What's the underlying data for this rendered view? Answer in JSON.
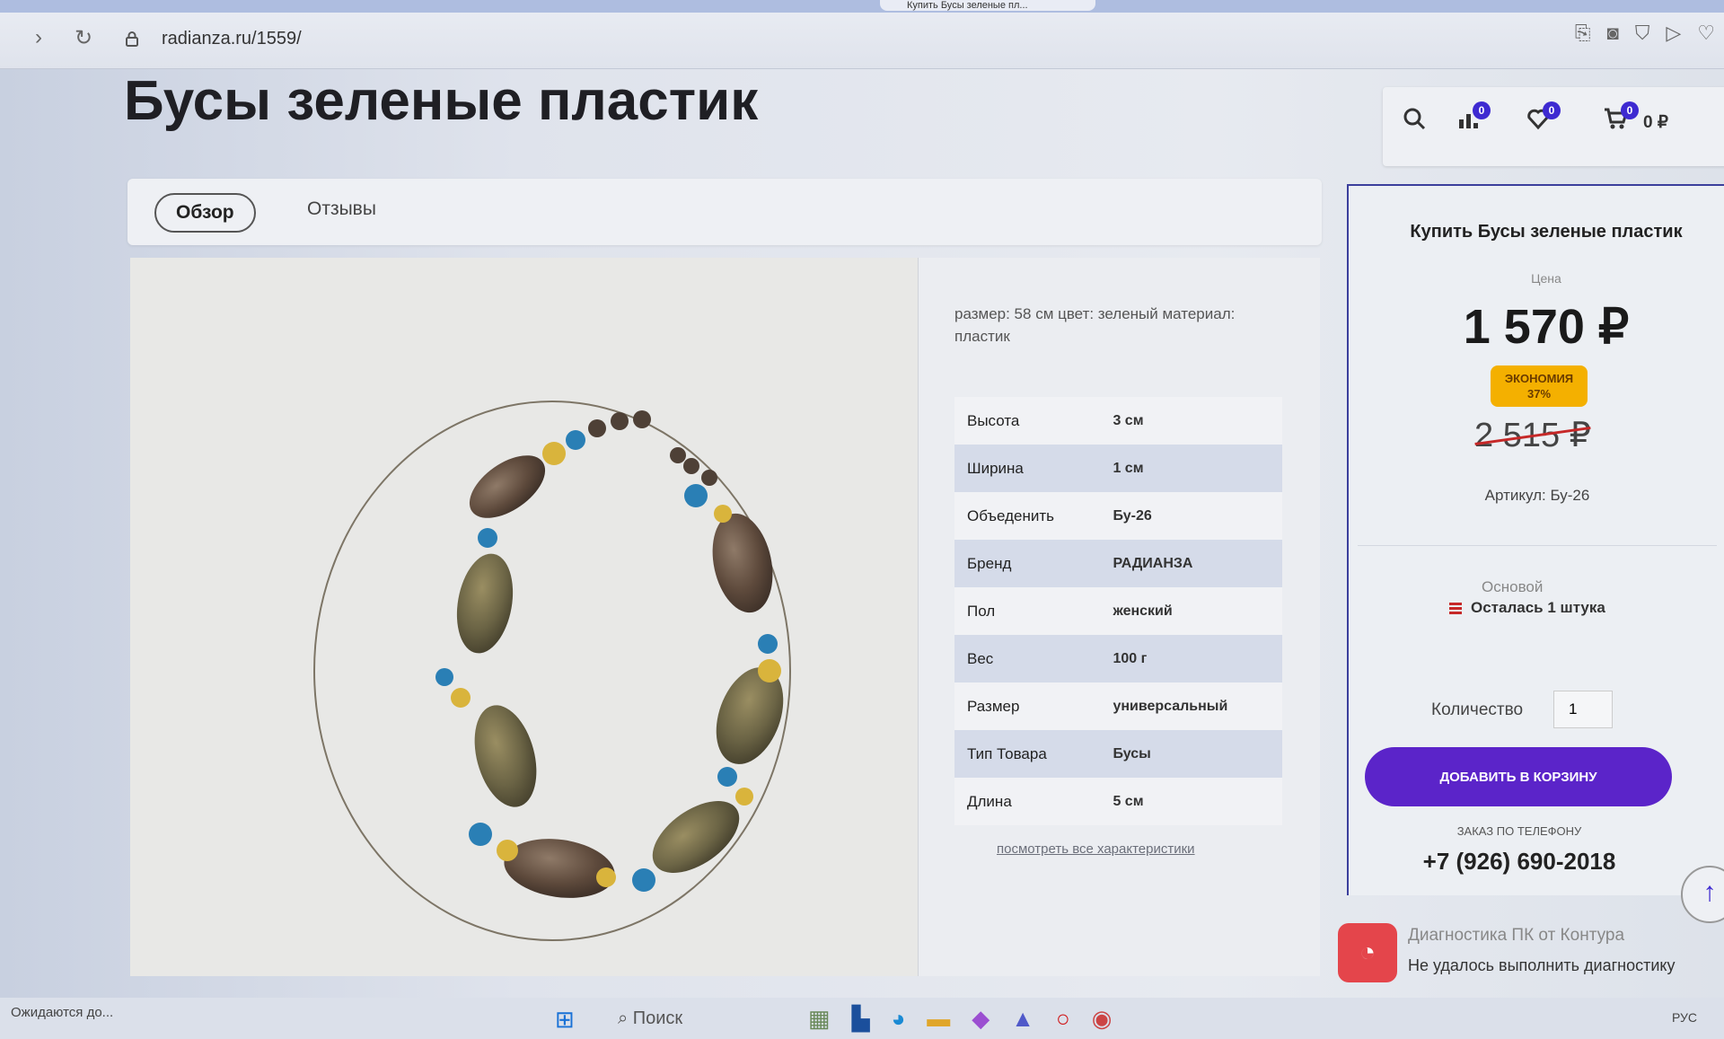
{
  "browser": {
    "url": "radianza.ru/1559/",
    "active_tab_title": "Купить Бусы зеленые пл...",
    "back": "‹",
    "forward": "›",
    "reload": "↻",
    "toolbar_icons": [
      "share-icon",
      "camera-icon",
      "shield-icon",
      "play-icon",
      "heart-icon"
    ]
  },
  "page": {
    "title": "Бусы зеленые пластик",
    "tabs": [
      {
        "label": "Обзор",
        "active": true
      },
      {
        "label": "Отзывы",
        "active": false
      }
    ],
    "description": "размер: 58 см цвет: зеленый материал: пластик",
    "specs": [
      {
        "name": "Высота",
        "value": "3 см"
      },
      {
        "name": "Ширина",
        "value": "1 см"
      },
      {
        "name": "Объеденить",
        "value": "Бу-26"
      },
      {
        "name": "Бренд",
        "value": "РАДИАНЗА"
      },
      {
        "name": "Пол",
        "value": "женский"
      },
      {
        "name": "Вес",
        "value": "100 г"
      },
      {
        "name": "Размер",
        "value": "универсальный"
      },
      {
        "name": "Тип Товара",
        "value": "Бусы"
      },
      {
        "name": "Длина",
        "value": "5 см"
      }
    ],
    "all_specs_link": "посмотреть все характеристики"
  },
  "header_icons": {
    "compare_count": "0",
    "wishlist_count": "0",
    "cart_count": "0",
    "cart_total": "0 ₽"
  },
  "buy": {
    "title": "Купить Бусы зеленые пластик",
    "price_label": "Цена",
    "price": "1 570 ₽",
    "savings_label": "ЭКОНОМИЯ",
    "savings_value": "37%",
    "old_price": "2 515 ₽",
    "sku": "Артикул: Бу-26",
    "warehouse": "Основой",
    "stock": "Осталась 1 штука",
    "qty_label": "Количество",
    "qty_value": "1",
    "add_button": "ДОБАВИТЬ В КОРЗИНУ",
    "phone_label": "ЗАКАЗ ПО ТЕЛЕФОНУ",
    "phone": "+7 (926) 690-2018"
  },
  "notification": {
    "title": "Диагностика ПК от Контура",
    "text": "Не удалось выполнить диагностику"
  },
  "taskbar": {
    "status": "Ожидаются до...",
    "search": "Поиск",
    "tray": "РУС"
  },
  "colors": {
    "accent": "#5b24c9",
    "badge": "#3e2ad1",
    "savings": "#f4b000",
    "strike": "#c62828"
  }
}
